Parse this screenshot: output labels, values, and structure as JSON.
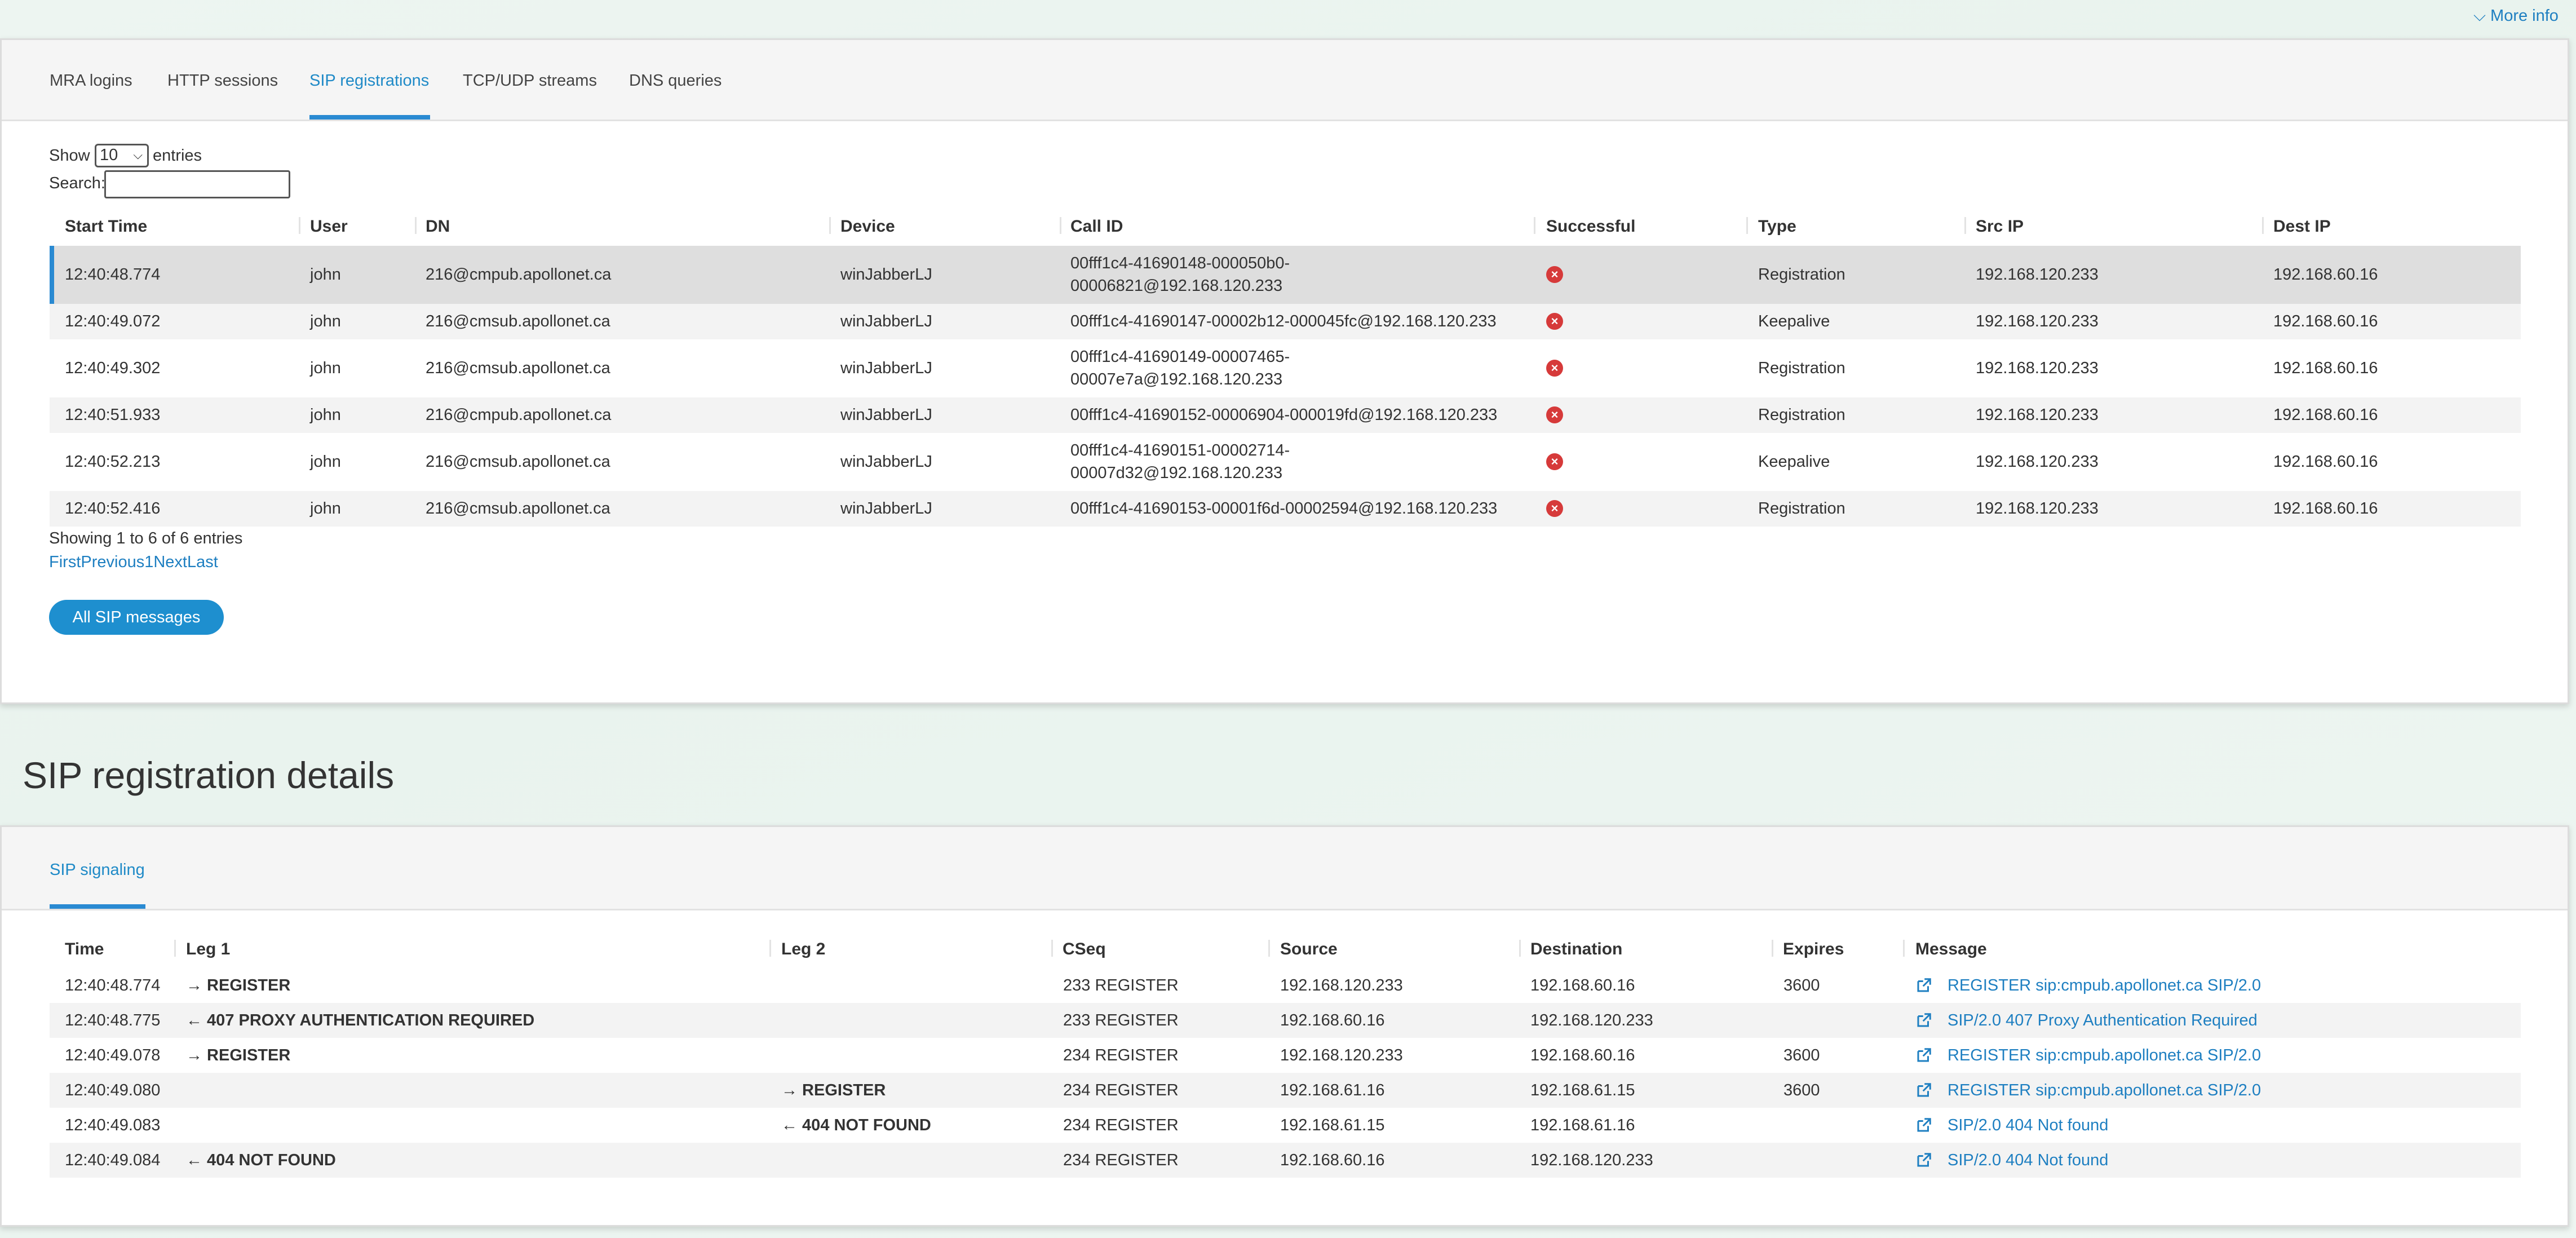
{
  "header": {
    "more_info": "More info"
  },
  "top_tabs": [
    {
      "label": "MRA logins"
    },
    {
      "label": "HTTP sessions"
    },
    {
      "label": "SIP registrations"
    },
    {
      "label": "TCP/UDP streams"
    },
    {
      "label": "DNS queries"
    }
  ],
  "controls": {
    "show_label": "Show",
    "page_size": "10",
    "entries_label": "entries",
    "search_label": "Search:",
    "search_value": ""
  },
  "reg_table": {
    "columns": [
      "Start Time",
      "User",
      "DN",
      "Device",
      "Call ID",
      "Successful",
      "Type",
      "Src IP",
      "Dest IP"
    ],
    "rows": [
      {
        "start_time": "12:40:48.774",
        "user": "john",
        "dn": "216@cmpub.apollonet.ca",
        "device": "winJabberLJ",
        "call_id_1": "00fff1c4-41690148-000050b0-",
        "call_id_2": "00006821@192.168.120.233",
        "type": "Registration",
        "src_ip": "192.168.120.233",
        "dest_ip": "192.168.60.16"
      },
      {
        "start_time": "12:40:49.072",
        "user": "john",
        "dn": "216@cmsub.apollonet.ca",
        "device": "winJabberLJ",
        "call_id_1": "00fff1c4-41690147-00002b12-000045fc@192.168.120.233",
        "call_id_2": "",
        "type": "Keepalive",
        "src_ip": "192.168.120.233",
        "dest_ip": "192.168.60.16"
      },
      {
        "start_time": "12:40:49.302",
        "user": "john",
        "dn": "216@cmsub.apollonet.ca",
        "device": "winJabberLJ",
        "call_id_1": "00fff1c4-41690149-00007465-",
        "call_id_2": "00007e7a@192.168.120.233",
        "type": "Registration",
        "src_ip": "192.168.120.233",
        "dest_ip": "192.168.60.16"
      },
      {
        "start_time": "12:40:51.933",
        "user": "john",
        "dn": "216@cmpub.apollonet.ca",
        "device": "winJabberLJ",
        "call_id_1": "00fff1c4-41690152-00006904-000019fd@192.168.120.233",
        "call_id_2": "",
        "type": "Registration",
        "src_ip": "192.168.120.233",
        "dest_ip": "192.168.60.16"
      },
      {
        "start_time": "12:40:52.213",
        "user": "john",
        "dn": "216@cmsub.apollonet.ca",
        "device": "winJabberLJ",
        "call_id_1": "00fff1c4-41690151-00002714-",
        "call_id_2": "00007d32@192.168.120.233",
        "type": "Keepalive",
        "src_ip": "192.168.120.233",
        "dest_ip": "192.168.60.16"
      },
      {
        "start_time": "12:40:52.416",
        "user": "john",
        "dn": "216@cmsub.apollonet.ca",
        "device": "winJabberLJ",
        "call_id_1": "00fff1c4-41690153-00001f6d-00002594@192.168.120.233",
        "call_id_2": "",
        "type": "Registration",
        "src_ip": "192.168.120.233",
        "dest_ip": "192.168.60.16"
      }
    ]
  },
  "pagination": {
    "info": "Showing 1 to 6 of 6 entries",
    "first": "First",
    "previous": "Previous",
    "page": "1",
    "next": "Next",
    "last": "Last"
  },
  "all_sip_button": "All SIP messages",
  "details": {
    "title": "SIP registration details",
    "tab": "SIP signaling",
    "columns": [
      "Time",
      "Leg 1",
      "Leg 2",
      "CSeq",
      "Source",
      "Destination",
      "Expires",
      "Message"
    ],
    "rows": [
      {
        "time": "12:40:48.774",
        "leg1": "→ REGISTER",
        "leg2": "",
        "cseq": "233 REGISTER",
        "source": "192.168.120.233",
        "destination": "192.168.60.16",
        "expires": "3600",
        "message": "REGISTER sip:cmpub.apollonet.ca SIP/2.0"
      },
      {
        "time": "12:40:48.775",
        "leg1": "← 407 PROXY AUTHENTICATION REQUIRED",
        "leg2": "",
        "cseq": "233 REGISTER",
        "source": "192.168.60.16",
        "destination": "192.168.120.233",
        "expires": "",
        "message": "SIP/2.0 407 Proxy Authentication Required"
      },
      {
        "time": "12:40:49.078",
        "leg1": "→ REGISTER",
        "leg2": "",
        "cseq": "234 REGISTER",
        "source": "192.168.120.233",
        "destination": "192.168.60.16",
        "expires": "3600",
        "message": "REGISTER sip:cmpub.apollonet.ca SIP/2.0"
      },
      {
        "time": "12:40:49.080",
        "leg1": "",
        "leg2": "→ REGISTER",
        "cseq": "234 REGISTER",
        "source": "192.168.61.16",
        "destination": "192.168.61.15",
        "expires": "3600",
        "message": "REGISTER sip:cmpub.apollonet.ca SIP/2.0"
      },
      {
        "time": "12:40:49.083",
        "leg1": "",
        "leg2": "← 404 NOT FOUND",
        "cseq": "234 REGISTER",
        "source": "192.168.61.15",
        "destination": "192.168.61.16",
        "expires": "",
        "message": "SIP/2.0 404 Not found"
      },
      {
        "time": "12:40:49.084",
        "leg1": "← 404 NOT FOUND",
        "leg2": "",
        "cseq": "234 REGISTER",
        "source": "192.168.60.16",
        "destination": "192.168.120.233",
        "expires": "",
        "message": "SIP/2.0 404 Not found"
      }
    ]
  },
  "colors": {
    "accent": "#2a8ad2",
    "link": "#1e7fc1",
    "error": "#d63a3a"
  }
}
